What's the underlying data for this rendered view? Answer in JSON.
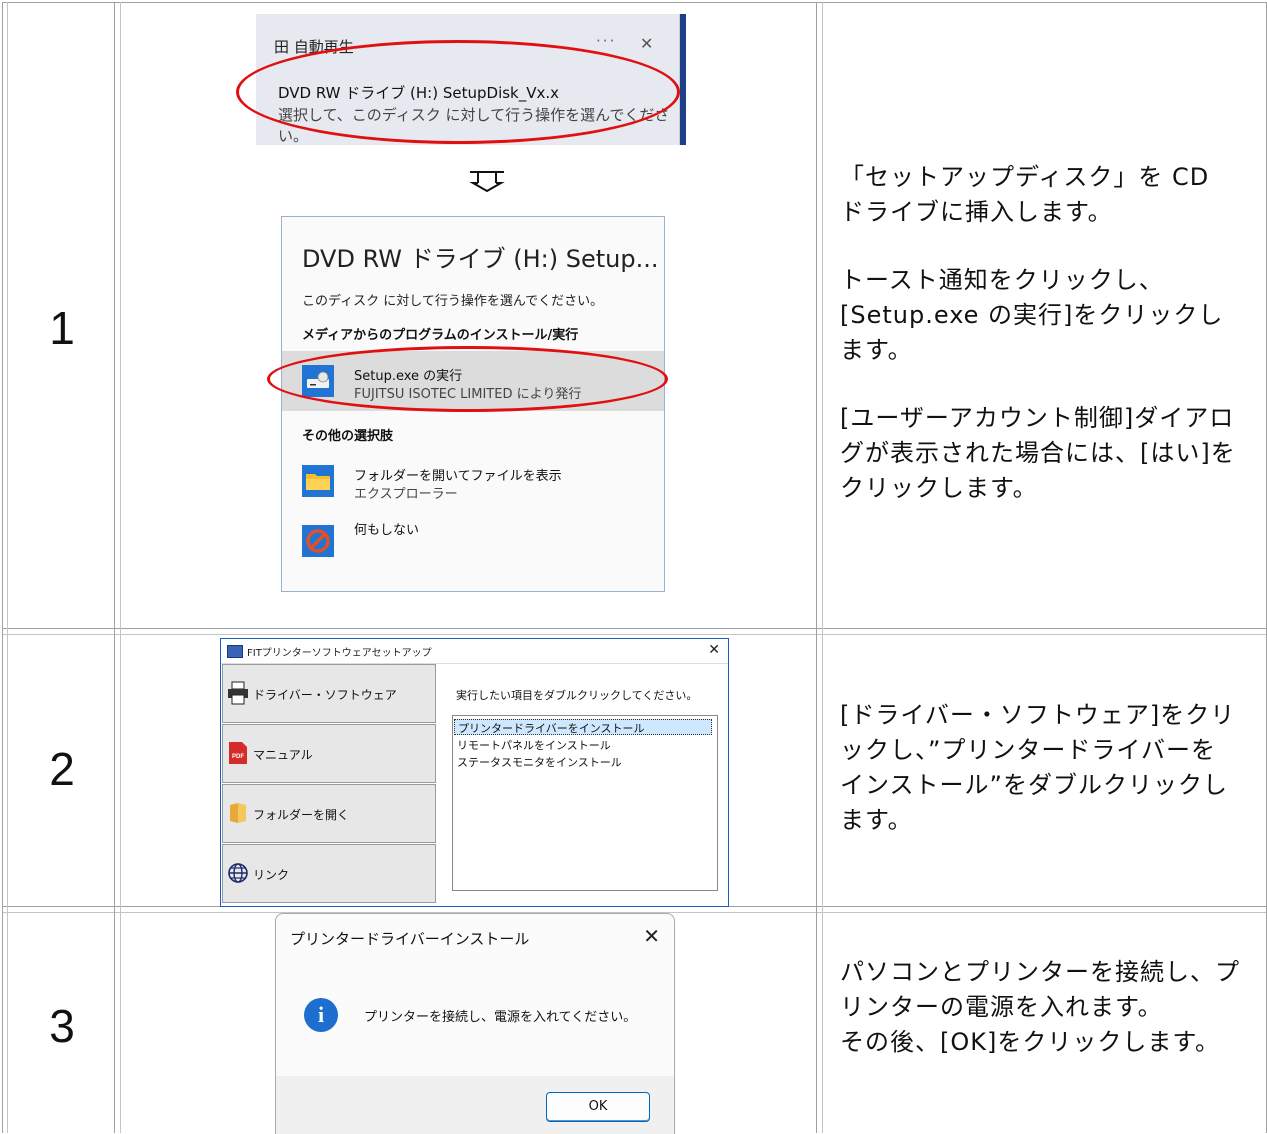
{
  "steps": [
    {
      "number": "1",
      "toast": {
        "header": "田 自動再生",
        "menu": "···",
        "close": "✕",
        "line1": "DVD RW ドライブ (H:) SetupDisk_Vx.x",
        "line2": "選択して、このディスク に対して行う操作を選んでください。"
      },
      "arrow": "⇩",
      "dialog": {
        "title": "DVD RW ドライブ (H:) Setup...",
        "subtitle": "このディスク に対して行う操作を選んでください。",
        "section1": "メディアからのプログラムのインストール/実行",
        "option1_line1": "Setup.exe の実行",
        "option1_line2": "FUJITSU ISOTEC LIMITED により発行",
        "section2": "その他の選択肢",
        "option2_line1": "フォルダーを開いてファイルを表示",
        "option2_line2": "エクスプローラー",
        "option3_line1": "何もしない"
      },
      "description": [
        "「セットアップディスク」を CD ドライブに挿入します。",
        "トースト通知をクリックし、[Setup.exe の実行]をクリックします。",
        "[ユーザーアカウント制御]ダイアログが表示された場合には、[はい]をクリックします。"
      ]
    },
    {
      "number": "2",
      "setup": {
        "title": "FITプリンターソフトウェアセットアップ",
        "close": "✕",
        "sidebar": [
          "ドライバー・ソフトウェア",
          "マニュアル",
          "フォルダーを開く",
          "リンク"
        ],
        "message": "実行したい項目をダブルクリックしてください。",
        "list": [
          "プリンタードライバーをインストール",
          "リモートパネルをインストール",
          "ステータスモニタをインストール"
        ],
        "pdf_badge": "PDF"
      },
      "description": [
        "[ドライバー・ソフトウェア]をクリックし、”プリンタードライバーをインストール”をダブルクリックします。"
      ]
    },
    {
      "number": "3",
      "msgbox": {
        "title": "プリンタードライバーインストール",
        "close": "✕",
        "icon": "i",
        "text": "プリンターを接続し、電源を入れてください。",
        "ok": "OK"
      },
      "description": [
        "パソコンとプリンターを接続し、プリンターの電源を入れます。",
        "その後、[OK]をクリックします。"
      ]
    }
  ],
  "colors": {
    "highlight_ellipse": "#e01010",
    "toast_bg": "#e6e9ef",
    "selected_option": "#dcdcdc",
    "info_icon": "#1d6ecf"
  }
}
